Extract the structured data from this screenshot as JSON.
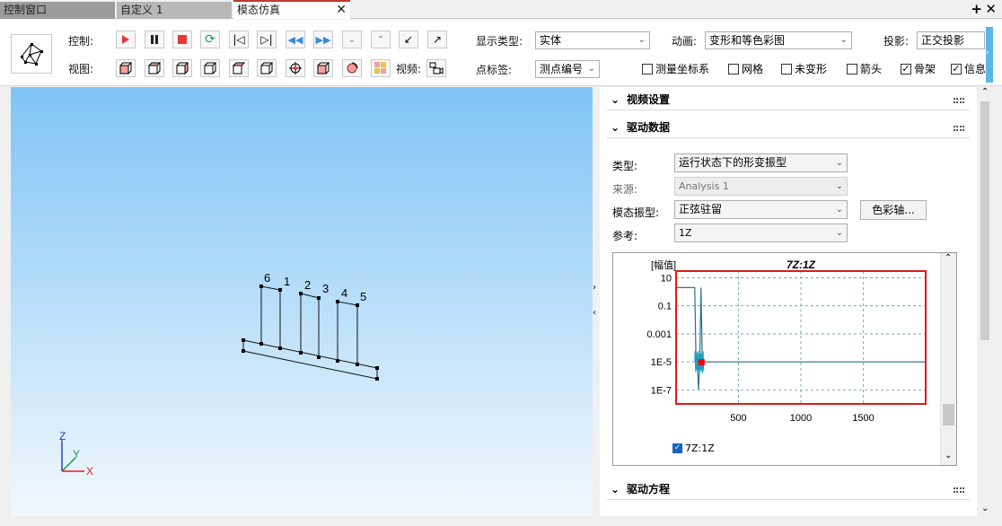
{
  "tabs": [
    {
      "label": "控制窗口"
    },
    {
      "label": "自定义 1"
    },
    {
      "label": "模态仿真",
      "active": true
    }
  ],
  "toolbar": {
    "control_label": "控制:",
    "view_label": "视图:",
    "video_label": "视频:",
    "display_type_label": "显示类型:",
    "display_type_value": "实体",
    "animation_label": "动画:",
    "animation_value": "变形和等色彩图",
    "projection_label": "投影:",
    "projection_value": "正交投影",
    "point_label_label": "点标签:",
    "point_label_value": "测点编号",
    "checkboxes": [
      {
        "label": "测量坐标系",
        "checked": false
      },
      {
        "label": "网格",
        "checked": false
      },
      {
        "label": "未变形",
        "checked": false
      },
      {
        "label": "箭头",
        "checked": false
      },
      {
        "label": "骨架",
        "checked": true
      },
      {
        "label": "信息",
        "checked": true
      }
    ]
  },
  "viewport": {
    "point_labels": [
      "6",
      "1",
      "2",
      "3",
      "4",
      "5"
    ],
    "axes": {
      "x": "X",
      "y": "Y",
      "z": "Z"
    }
  },
  "panel": {
    "video_settings": "视频设置",
    "drive_data": "驱动数据",
    "drive_equation": "驱动方程",
    "type_label": "类型:",
    "type_value": "运行状态下的形变振型",
    "source_label": "来源:",
    "source_value": "Analysis 1",
    "mode_label": "模态振型:",
    "mode_value": "正弦驻留",
    "color_axis_button": "色彩轴...",
    "reference_label": "参考:",
    "reference_value": "1Z"
  },
  "chart_data": {
    "type": "line",
    "title": "7Z:1Z",
    "ylabel": "[幅值]",
    "y_scale": "log",
    "y_ticks": [
      "10",
      "0.1",
      "0.001",
      "1E-5",
      "1E-7"
    ],
    "x_ticks": [
      "500",
      "1000",
      "1500"
    ],
    "xlim": [
      0,
      2000
    ],
    "ylim": [
      1e-08,
      30
    ],
    "series": [
      {
        "name": "7Z:1Z",
        "color": "#2e6f8f",
        "x": [
          0,
          150,
          160,
          170,
          180,
          190,
          200,
          210,
          230,
          2000
        ],
        "y": [
          2,
          2,
          1e-05,
          1e-05,
          1e-07,
          1e-05,
          2,
          1e-05,
          1e-05,
          1e-05
        ]
      }
    ],
    "legend": [
      {
        "label": "7Z:1Z",
        "checked": true
      }
    ],
    "highlight_color": "#e0191a",
    "cursor_color": "#ff0000"
  }
}
